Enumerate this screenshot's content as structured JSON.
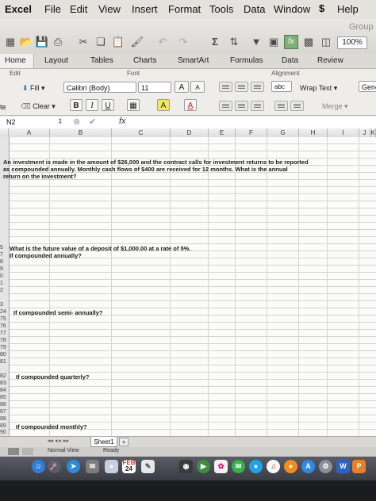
{
  "menubar": {
    "app": "Excel",
    "items": [
      "File",
      "Edit",
      "View",
      "Insert",
      "Format",
      "Tools",
      "Data",
      "Window",
      "Help"
    ]
  },
  "toolbar": {
    "group_label": "Group",
    "zoom": "100%",
    "fx_button": "fx"
  },
  "ribbon_tabs": [
    "Home",
    "Layout",
    "Tables",
    "Charts",
    "SmartArt",
    "Formulas",
    "Data",
    "Review"
  ],
  "ribbon": {
    "edit_group": "Edit",
    "font_group": "Font",
    "alignment_group": "Alignment",
    "fill_label": "Fill",
    "clear_label": "Clear",
    "font_name": "Calibri (Body)",
    "font_size": "11",
    "grow_font": "A",
    "shrink_font": "A",
    "bold": "B",
    "italic": "I",
    "underline": "U",
    "highlight_letter": "A",
    "text_color_letter": "A",
    "abc_label": "abc",
    "wrap_text": "Wrap Text",
    "merge": "Merge",
    "number_format": "Gene",
    "paste_partial": "te"
  },
  "formula_bar": {
    "cell_ref": "N2",
    "fx": "fx"
  },
  "columns": [
    "A",
    "B",
    "C",
    "D",
    "E",
    "F",
    "G",
    "H",
    "I",
    "J",
    "K"
  ],
  "rows": {
    "r5": "5",
    "r7": "7",
    "r8": "8",
    "r9": "9",
    "r0": "0",
    "r1": "1",
    "r2": "2",
    "r3": "3",
    "r24": "24",
    "r75": "75",
    "r76": "76",
    "r77": "77",
    "r78": "78",
    "r79": "79",
    "r80": "80",
    "r81": "81",
    "r82": "82",
    "r83": "83",
    "r84": "84",
    "r85": "85",
    "r86": "86",
    "r87": "87",
    "r88": "88",
    "r89": "89",
    "r90": "90"
  },
  "cells": {
    "q1_line1": "An investment is made in the amount of $26,000 and the contract calls for investment returns to be reported",
    "q1_line2": "as compounded annually. Monthly cash flows of $400 are received for 12 months. What is the annual",
    "q1_line3": "return on the investment?",
    "q2_line1": "What is the  future value of a deposit of $1,000.00 at a rate of 5%.",
    "q2_line2": "If compounded annually?",
    "q3": "If compounded semi- annually?",
    "q4": "If compounded quarterly?",
    "q5": "If compounded monthly?"
  },
  "sheet": {
    "tab": "Sheet1",
    "add": "+",
    "nav": "◂◂ ◂ ▸ ▸▸",
    "view": "Normal View",
    "status": "Ready"
  },
  "dock": {
    "calendar_day": "24",
    "calendar_month": "FEB"
  }
}
